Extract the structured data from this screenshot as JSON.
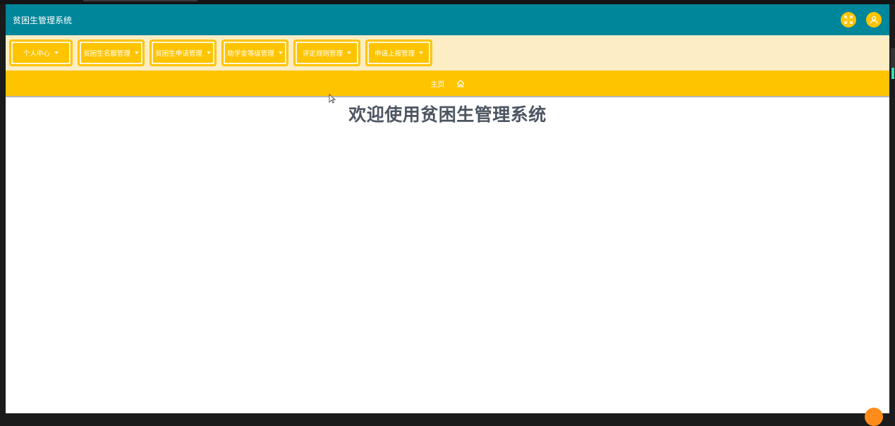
{
  "header": {
    "title": "贫困生管理系统",
    "icons": [
      "fullscreen-icon",
      "user-icon"
    ]
  },
  "menu": {
    "items": [
      {
        "label": "个人中心"
      },
      {
        "label": "贫困生名额管理"
      },
      {
        "label": "贫困生申请管理"
      },
      {
        "label": "助学金等级管理"
      },
      {
        "label": "评定规则管理"
      },
      {
        "label": "申请上报管理"
      }
    ]
  },
  "breadcrumb": {
    "home_label": "主页",
    "icon": "home-icon"
  },
  "main": {
    "welcome": "欢迎使用贫困生管理系统"
  },
  "colors": {
    "header_bg": "#00869a",
    "accent": "#ffc400",
    "menubar_bg": "#fcedc5",
    "welcome_text": "#4d5562"
  }
}
